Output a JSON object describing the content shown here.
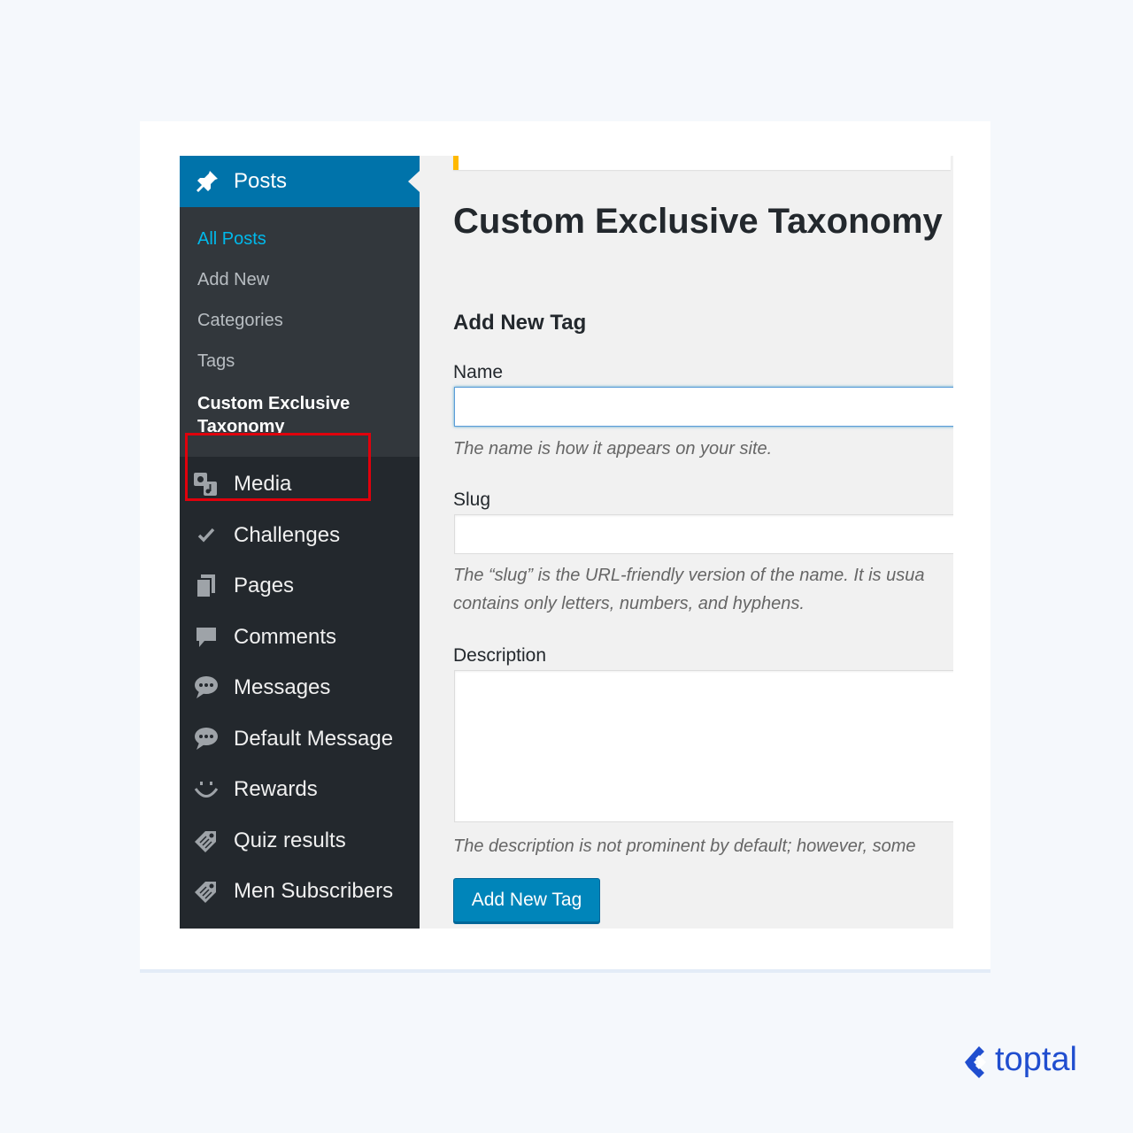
{
  "sidebar": {
    "posts_label": "Posts",
    "submenu": {
      "all_posts": "All Posts",
      "add_new": "Add New",
      "categories": "Categories",
      "tags": "Tags",
      "custom_line1": "Custom Exclusive",
      "custom_line2": "Taxonomy"
    },
    "menu": [
      {
        "label": "Media",
        "icon": "media-icon"
      },
      {
        "label": "Challenges",
        "icon": "checkmark-icon"
      },
      {
        "label": "Pages",
        "icon": "pages-icon"
      },
      {
        "label": "Comments",
        "icon": "comment-icon"
      },
      {
        "label": "Messages",
        "icon": "chat-bubble-icon"
      },
      {
        "label": "Default Message",
        "icon": "chat-bubble-icon"
      },
      {
        "label": "Rewards",
        "icon": "smiley-icon"
      },
      {
        "label": "Quiz results",
        "icon": "tag-icon"
      },
      {
        "label": "Men Subscribers",
        "icon": "tag-icon"
      }
    ]
  },
  "main": {
    "title": "Custom Exclusive Taxonomy",
    "section_title": "Add New Tag",
    "name_label": "Name",
    "name_value": "",
    "name_help": "The name is how it appears on your site.",
    "slug_label": "Slug",
    "slug_value": "",
    "slug_help_line1": "The “slug” is the URL-friendly version of the name. It is usua",
    "slug_help_line2": "contains only letters, numbers, and hyphens.",
    "description_label": "Description",
    "description_value": "",
    "description_help": "The description is not prominent by default; however, some",
    "submit_label": "Add New Tag"
  },
  "brand": {
    "name": "toptal"
  },
  "colors": {
    "admin_blue": "#0073aa",
    "sidebar_dark": "#23282d",
    "submenu_dark": "#32373c",
    "highlight_red": "#e0000c",
    "notice_yellow": "#ffb900",
    "toptal_blue": "#204ecf"
  }
}
